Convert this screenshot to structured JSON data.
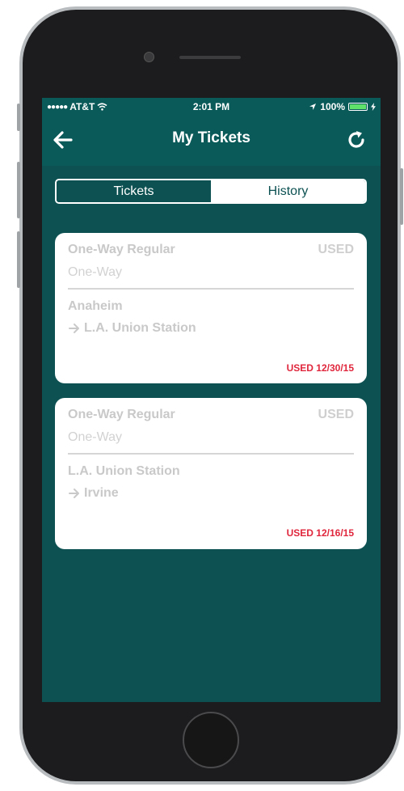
{
  "status_bar": {
    "carrier": "AT&T",
    "signal_dots": "●●●●●",
    "time": "2:01 PM",
    "battery": "100%",
    "battery_level": 1.0
  },
  "nav": {
    "title": "My Tickets"
  },
  "tabs": [
    {
      "label": "Tickets",
      "active": true
    },
    {
      "label": "History",
      "active": false
    }
  ],
  "tickets": [
    {
      "type": "One-Way Regular",
      "status": "USED",
      "subtype": "One-Way",
      "from": "Anaheim",
      "to": "L.A. Union Station",
      "used_label": "USED 12/30/15"
    },
    {
      "type": "One-Way Regular",
      "status": "USED",
      "subtype": "One-Way",
      "from": "L.A. Union Station",
      "to": "Irvine",
      "used_label": "USED 12/16/15"
    }
  ],
  "colors": {
    "header": "#0b5a5a",
    "background": "#0d5152",
    "used_red": "#e0263c"
  }
}
